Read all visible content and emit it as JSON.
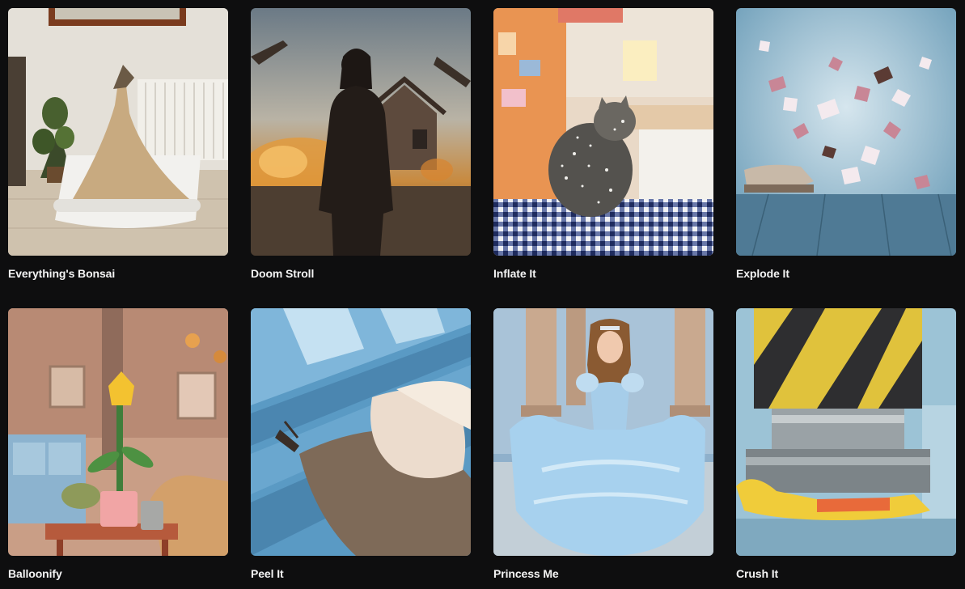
{
  "effects": [
    {
      "title": "Everything's Bonsai",
      "thumbnail": "bonsai-sand-litterbox"
    },
    {
      "title": "Doom Stroll",
      "thumbnail": "woman-walking-destroyed-town"
    },
    {
      "title": "Inflate It",
      "thumbnail": "glitter-cat-on-table"
    },
    {
      "title": "Explode It",
      "thumbnail": "exploding-shoe"
    },
    {
      "title": "Balloonify",
      "thumbnail": "balloon-flower-living-room"
    },
    {
      "title": "Peel It",
      "thumbnail": "peeled-animal-on-blue-boards"
    },
    {
      "title": "Princess Me",
      "thumbnail": "woman-in-blue-ballgown"
    },
    {
      "title": "Crush It",
      "thumbnail": "hydraulic-press-crushing"
    }
  ]
}
